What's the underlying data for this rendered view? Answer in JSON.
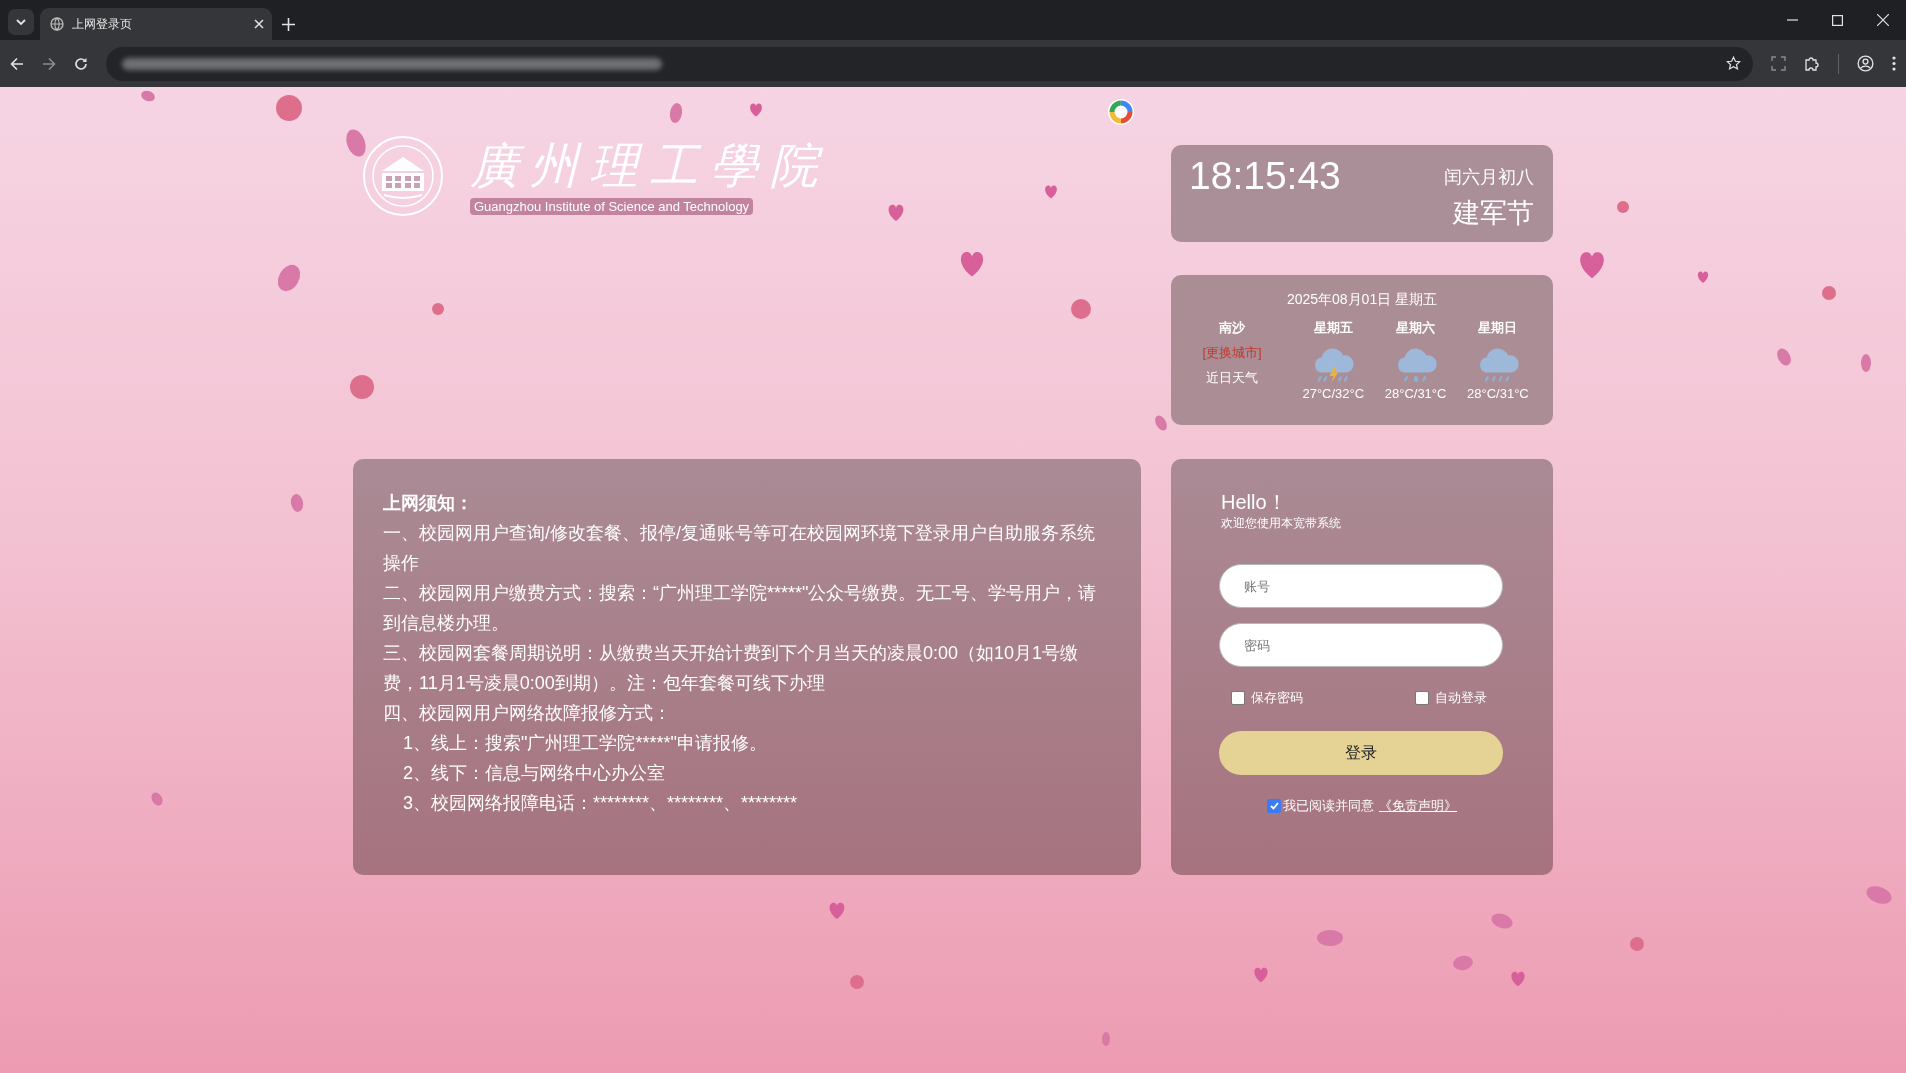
{
  "browser": {
    "tab": {
      "title": "上网登录页",
      "selected": true
    }
  },
  "logo": {
    "name": "廣州理工學院",
    "subtitle": "Guangzhou Institute of Science and Technology"
  },
  "clock": {
    "time": "18:15:43",
    "lunar_date": "闰六月初八",
    "festival": "建军节"
  },
  "weather": {
    "date": "2025年08月01日 星期五",
    "city": "南沙",
    "change_city": "[更换城市]",
    "label": "近日天气",
    "days": [
      {
        "day": "星期五",
        "kind": "thunderstorm",
        "temp": "27°C/32°C"
      },
      {
        "day": "星期六",
        "kind": "rain",
        "temp": "28°C/31°C"
      },
      {
        "day": "星期日",
        "kind": "showers",
        "temp": "28°C/31°C"
      }
    ]
  },
  "notice": {
    "title": "上网须知：",
    "items": [
      {
        "text": "一、校园网用户查询/修改套餐、报停/复通账号等可在校园网环境下登录用户自助服务系统操作"
      },
      {
        "text": "二、校园网用户缴费方式：搜索：“广州理工学院*****\"公众号缴费。无工号、学号用户，请到信息楼办理。"
      },
      {
        "text": "三、校园网套餐周期说明：从缴费当天开始计费到下个月当天的凌晨0:00（如10月1号缴费，11月1号凌晨0:00到期）。注：包年套餐可线下办理"
      },
      {
        "text": "四、校园网用户网络故障报修方式：",
        "children": [
          {
            "text": "1、线上：搜索\"广州理工学院*****\"申请报修。"
          },
          {
            "text": "2、线下：信息与网络中心办公室"
          },
          {
            "text": "3、校园网络报障电话：********、********、********"
          }
        ]
      }
    ]
  },
  "login": {
    "greeting": "Hello！",
    "subtitle": "欢迎您使用本宽带系统",
    "fields": [
      {
        "placeholder": "账号"
      },
      {
        "placeholder": "密码"
      }
    ],
    "options": [
      {
        "label": "保存密码",
        "checked": false
      },
      {
        "label": "自动登录",
        "checked": false
      }
    ],
    "button": "登录",
    "agreement": {
      "text": "我已阅读并同意",
      "link": "《免责声明》",
      "checked": true
    }
  }
}
